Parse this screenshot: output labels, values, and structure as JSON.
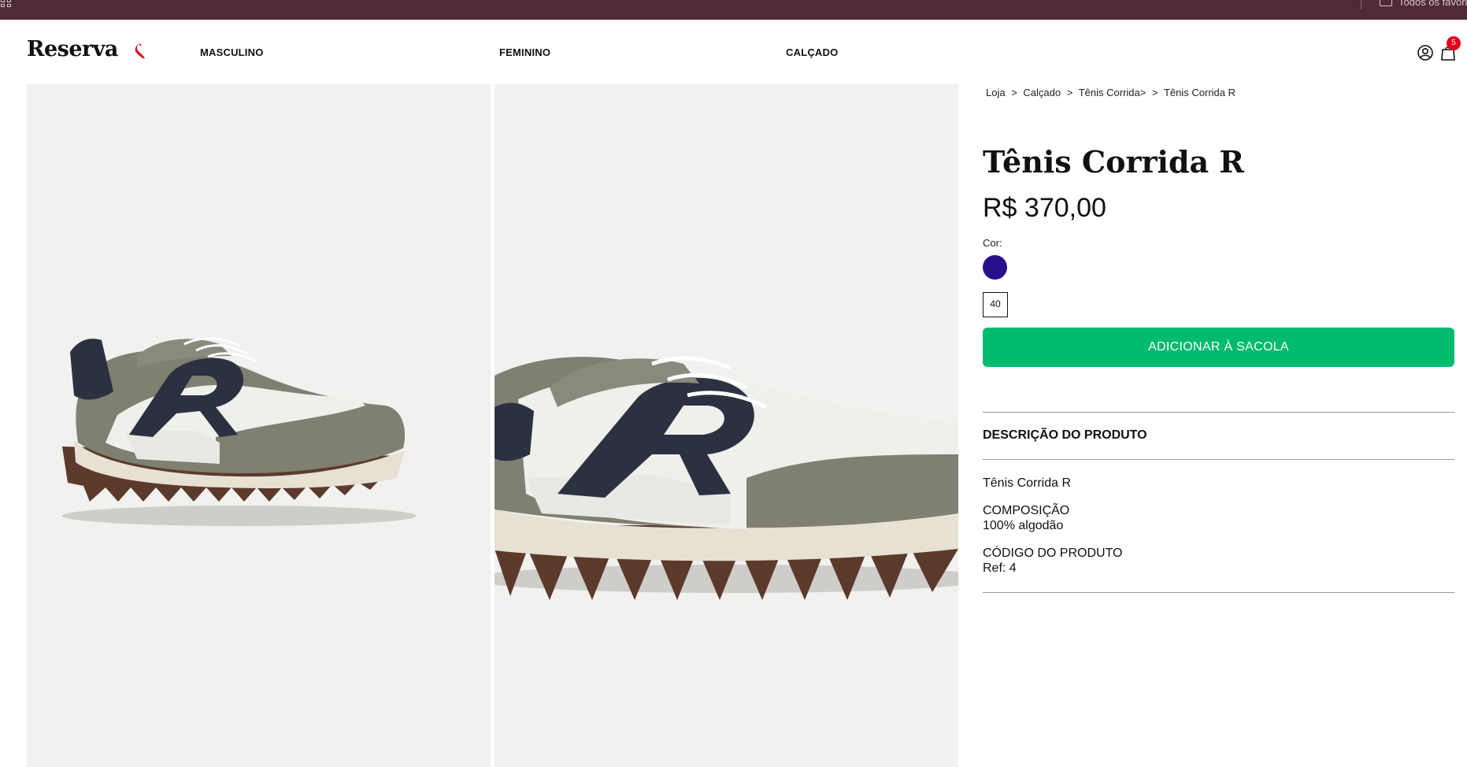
{
  "browser": {
    "bookmarks_label": "Todos os favoritos"
  },
  "header": {
    "logo": "Reserva",
    "nav": [
      "MASCULINO",
      "FEMININO",
      "CALÇADO"
    ],
    "cart_count": "5"
  },
  "breadcrumb": [
    "Loja",
    ">",
    "Calçado",
    ">",
    "Tênis Corrida>",
    ">",
    "Tênis Corrida R"
  ],
  "product": {
    "title": "Tênis Corrida R",
    "price": "R$ 370,00",
    "color_label": "Cor:",
    "color_swatch": "#2a0f8a",
    "size": "40",
    "add_button": "ADICIONAR À SACOLA"
  },
  "description": {
    "heading": "DESCRIÇÃO DO PRODUTO",
    "name": "Tênis Corrida R",
    "composition_label": "COMPOSIÇÃO",
    "composition_value": "100% algodão",
    "code_label": "CÓDIGO DO PRODUTO",
    "code_value": "Ref: 4"
  },
  "colors": {
    "top_bar": "#4f2a37",
    "accent_green": "#00ba6e",
    "badge_red": "#e3001b",
    "photo_bg": "#f2f1ef"
  }
}
